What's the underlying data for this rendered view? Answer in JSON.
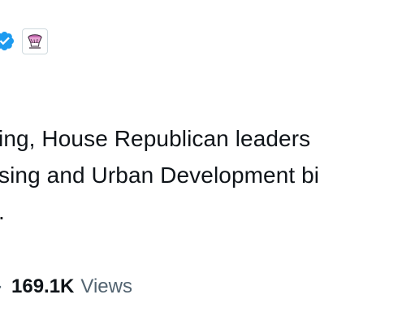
{
  "header": {
    "verified_badge_icon": "verified-badge-icon",
    "affiliate_badge_icon": "affiliate-organization-icon",
    "verified_color": "#1d9bf0"
  },
  "tweet": {
    "lines": [
      "ing, House Republican leaders",
      "sing and Urban Development bi",
      "."
    ]
  },
  "meta": {
    "separator": "·",
    "views_count": "169.1K",
    "views_label": "Views"
  }
}
